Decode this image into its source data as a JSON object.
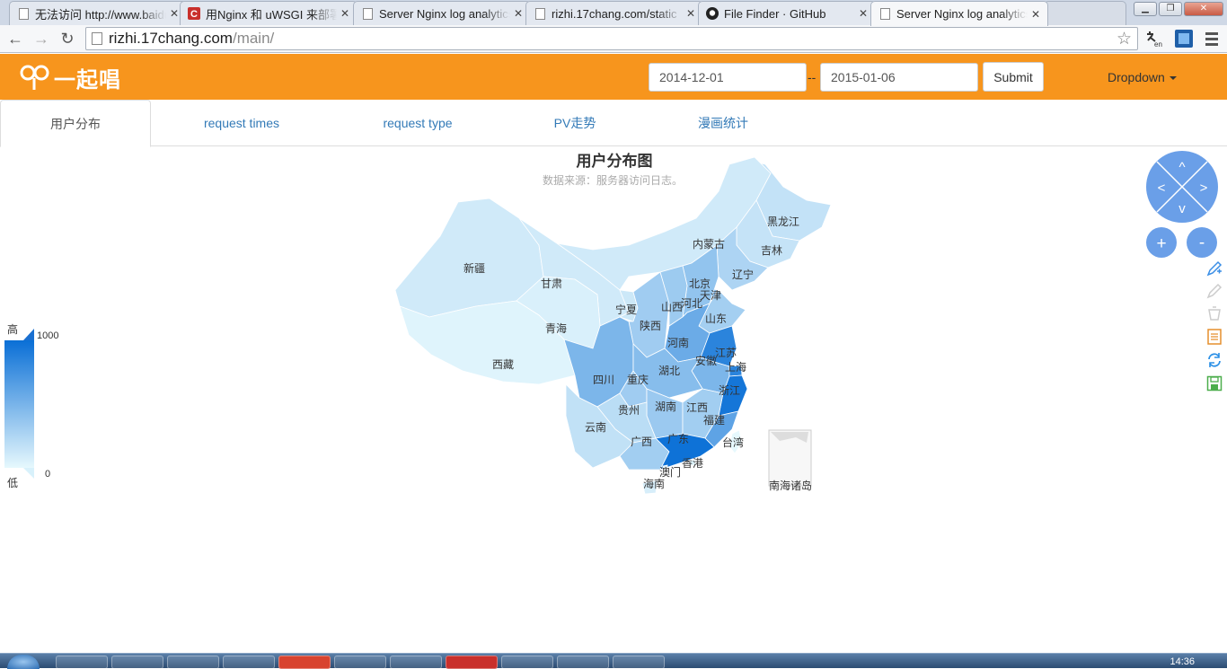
{
  "browser": {
    "tabs": [
      {
        "title": "无法访问 http://www.baidu.com",
        "icon": "page-icon"
      },
      {
        "title": "用Nginx 和 uWSGI 来部署",
        "icon": "csdn-icon"
      },
      {
        "title": "Server Nginx log analytics",
        "icon": "page-icon"
      },
      {
        "title": "rizhi.17chang.com/static",
        "icon": "page-icon"
      },
      {
        "title": "File Finder · GitHub",
        "icon": "github-icon"
      },
      {
        "title": "Server Nginx log analytics",
        "icon": "page-icon"
      }
    ],
    "active_tab": 5,
    "url_host": "rizhi.17chang.com",
    "url_path": "/main/"
  },
  "header": {
    "logo_text": "一起唱",
    "start_date": "2014-12-01",
    "date_separator": "--",
    "end_date": "2015-01-06",
    "submit_label": "Submit",
    "dropdown_label": "Dropdown",
    "accent_color": "#f7951d"
  },
  "nav": {
    "tabs": [
      {
        "label": "用户分布",
        "active": true
      },
      {
        "label": "request times",
        "active": false
      },
      {
        "label": "request type",
        "active": false
      },
      {
        "label": "PV走势",
        "active": false
      },
      {
        "label": "漫画统计",
        "active": false
      }
    ]
  },
  "chart_data": {
    "type": "map",
    "title": "用户分布图",
    "subtitle": "数据来源：服务器访问日志。",
    "visual_map": {
      "max": 1000,
      "min": 0,
      "high_label": "高",
      "low_label": "低",
      "max_label": "1000",
      "min_label": "0",
      "color_high": "#0a6fd6",
      "color_low": "#e6f8fd"
    },
    "regions": [
      {
        "name": "黑龙江",
        "value": 160
      },
      {
        "name": "吉林",
        "value": 150
      },
      {
        "name": "辽宁",
        "value": 260
      },
      {
        "name": "内蒙古",
        "value": 100
      },
      {
        "name": "北京",
        "value": 850
      },
      {
        "name": "天津",
        "value": 420
      },
      {
        "name": "河北",
        "value": 380
      },
      {
        "name": "山西",
        "value": 330
      },
      {
        "name": "山东",
        "value": 300
      },
      {
        "name": "新疆",
        "value": 100
      },
      {
        "name": "甘肃",
        "value": 100
      },
      {
        "name": "宁夏",
        "value": 120
      },
      {
        "name": "青海",
        "value": 60
      },
      {
        "name": "陕西",
        "value": 320
      },
      {
        "name": "河南",
        "value": 560
      },
      {
        "name": "江苏",
        "value": 850
      },
      {
        "name": "安徽",
        "value": 480
      },
      {
        "name": "上海",
        "value": 850
      },
      {
        "name": "西藏",
        "value": 30
      },
      {
        "name": "四川",
        "value": 480
      },
      {
        "name": "重庆",
        "value": 320
      },
      {
        "name": "湖北",
        "value": 430
      },
      {
        "name": "浙江",
        "value": 950
      },
      {
        "name": "湖南",
        "value": 340
      },
      {
        "name": "江西",
        "value": 310
      },
      {
        "name": "贵州",
        "value": 200
      },
      {
        "name": "福建",
        "value": 620
      },
      {
        "name": "云南",
        "value": 170
      },
      {
        "name": "广西",
        "value": 310
      },
      {
        "name": "广东",
        "value": 980
      },
      {
        "name": "台湾",
        "value": 0
      },
      {
        "name": "香港",
        "value": 40
      },
      {
        "name": "澳门",
        "value": 20
      },
      {
        "name": "海南",
        "value": 70
      },
      {
        "name": "南海诸岛",
        "value": 0
      }
    ]
  },
  "map_controls": {
    "up": "^",
    "left": "<",
    "right": ">",
    "down": "v",
    "zoom_in": "+",
    "zoom_out": "-"
  },
  "toolbox": [
    "pen-icon",
    "eraser-icon",
    "clear-icon",
    "data-view-icon",
    "restore-icon",
    "save-image-icon"
  ],
  "taskbar": {
    "clock": "14:36"
  }
}
